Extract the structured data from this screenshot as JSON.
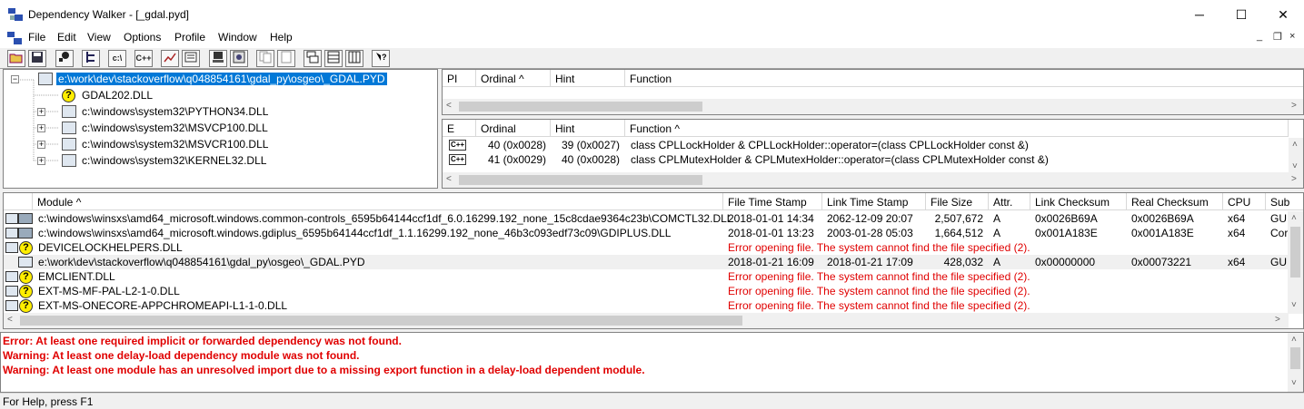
{
  "window": {
    "title": "Dependency Walker - [_gdal.pyd]",
    "minimize": "─",
    "maximize": "☐",
    "close": "✕"
  },
  "menu": [
    "File",
    "Edit",
    "View",
    "Options",
    "Profile",
    "Window",
    "Help"
  ],
  "mdi": {
    "minimize": "_",
    "restore": "❐",
    "close": "×"
  },
  "toolbar": {
    "buttons": [
      "open",
      "save",
      "find",
      "full-paths",
      "c-cpp",
      "c++",
      "copy",
      "properties",
      "system-info",
      "highlight",
      "show-log",
      "tile-panes",
      "module-list",
      "import-export",
      "help"
    ],
    "c_label": "c:\\",
    "cpp_label": "C++"
  },
  "tree": {
    "root": "e:\\work\\dev\\stackoverflow\\q048854161\\gdal_py\\osgeo\\_GDAL.PYD",
    "children": [
      {
        "name": "GDAL202.DLL"
      },
      {
        "name": "c:\\windows\\system32\\PYTHON34.DLL"
      },
      {
        "name": "c:\\windows\\system32\\MSVCP100.DLL"
      },
      {
        "name": "c:\\windows\\system32\\MSVCR100.DLL"
      },
      {
        "name": "c:\\windows\\system32\\KERNEL32.DLL"
      }
    ]
  },
  "imports_header": [
    "PI",
    "Ordinal ^",
    "Hint",
    "Function"
  ],
  "exports_header": [
    "E",
    "Ordinal",
    "Hint",
    "Function ^"
  ],
  "exports": [
    {
      "icon": "C++",
      "ordinal": "40 (0x0028)",
      "hint": "39 (0x0027)",
      "function": "class CPLLockHolder & CPLLockHolder::operator=(class CPLLockHolder const &)"
    },
    {
      "icon": "C++",
      "ordinal": "41 (0x0029)",
      "hint": "40 (0x0028)",
      "function": "class CPLMutexHolder & CPLMutexHolder::operator=(class CPLMutexHolder const &)"
    }
  ],
  "modules_header": [
    "Module ^",
    "File Time Stamp",
    "Link Time Stamp",
    "File Size",
    "Attr.",
    "Link Checksum",
    "Real Checksum",
    "CPU",
    "Sub"
  ],
  "modules": [
    {
      "module": "c:\\windows\\winsxs\\amd64_microsoft.windows.common-controls_6595b64144ccf1df_6.0.16299.192_none_15c8cdae9364c23b\\COMCTL32.DLL",
      "file_ts": "2018-01-01 14:34",
      "link_ts": "2062-12-09 20:07",
      "size": "2,507,672",
      "attr": "A",
      "link_ck": "0x0026B69A",
      "real_ck": "0x0026B69A",
      "cpu": "x64",
      "sub": "GU"
    },
    {
      "module": "c:\\windows\\winsxs\\amd64_microsoft.windows.gdiplus_6595b64144ccf1df_1.1.16299.192_none_46b3c093edf73c09\\GDIPLUS.DLL",
      "file_ts": "2018-01-01 13:23",
      "link_ts": "2003-01-28 05:03",
      "size": "1,664,512",
      "attr": "A",
      "link_ck": "0x001A183E",
      "real_ck": "0x001A183E",
      "cpu": "x64",
      "sub": "Cor"
    },
    {
      "module": "DEVICELOCKHELPERS.DLL",
      "error": "Error opening file. The system cannot find the file specified (2)."
    },
    {
      "module": "e:\\work\\dev\\stackoverflow\\q048854161\\gdal_py\\osgeo\\_GDAL.PYD",
      "file_ts": "2018-01-21 16:09",
      "link_ts": "2018-01-21 17:09",
      "size": "428,032",
      "attr": "A",
      "link_ck": "0x00000000",
      "real_ck": "0x00073221",
      "cpu": "x64",
      "sub": "GU"
    },
    {
      "module": "EMCLIENT.DLL",
      "error": "Error opening file. The system cannot find the file specified (2)."
    },
    {
      "module": "EXT-MS-MF-PAL-L2-1-0.DLL",
      "error": "Error opening file. The system cannot find the file specified (2)."
    },
    {
      "module": "EXT-MS-ONECORE-APPCHROMEAPI-L1-1-0.DLL",
      "error": "Error opening file. The system cannot find the file specified (2)."
    }
  ],
  "log": [
    "Error: At least one required implicit or forwarded dependency was not found.",
    "Warning: At least one delay-load dependency module was not found.",
    "Warning: At least one module has an unresolved import due to a missing export function in a delay-load dependent module."
  ],
  "status": "For Help, press F1"
}
